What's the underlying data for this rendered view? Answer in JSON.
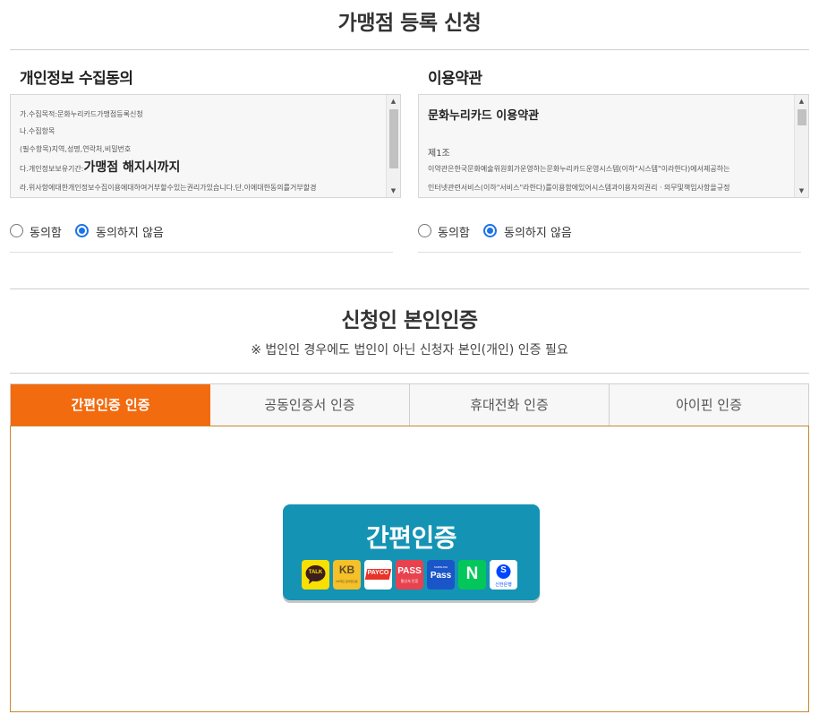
{
  "page": {
    "title": "가맹점 등록 신청"
  },
  "privacy": {
    "title": "개인정보 수집동의",
    "lines": [
      "가.수집목적:문화누리카드가맹점등록신청",
      "나.수집항목",
      "(필수항목)지역,성명,연락처,비밀번호",
      "다.개인정보보유기간:",
      "라.위사항에대한개인정보수집이용에대하여거부할수있는권리가있습니다.단,이에대한동의를거부할경"
    ],
    "emphasis": "가맹점 해지시까지",
    "agree_label": "동의함",
    "disagree_label": "동의하지 않음",
    "selected": "disagree"
  },
  "terms": {
    "title": "이용약관",
    "lines": [
      "문화누리카드 이용약관",
      "제1조",
      "이약관은한국문화예술위원회가운영하는문화누리카드운영시스템(이하\"시스템\"이라한다)에서제공하는",
      "인터넷관련서비스(이하\"서비스\"라한다)를이용함에있어시스템과이용자의권리ㆍ의무및책임사항을규정"
    ],
    "agree_label": "동의함",
    "disagree_label": "동의하지 않음",
    "selected": "disagree"
  },
  "auth": {
    "title": "신청인 본인인증",
    "note": "※ 법인인 경우에도 법인이 아닌 신청자 본인(개인) 인증 필요",
    "tabs": [
      "간편인증 인증",
      "공동인증서 인증",
      "휴대전화 인증",
      "아이핀 인증"
    ],
    "active_tab": 0,
    "easy_button_label": "간편인증",
    "logos": [
      {
        "name": "kakao-talk-icon",
        "text": "TALK",
        "color": "#f9e000"
      },
      {
        "name": "kb-bank-icon",
        "text": "KB",
        "subtext": "KB국민 모바일인증",
        "color": "#f5c028"
      },
      {
        "name": "payco-icon",
        "text": "PAYCO",
        "color": "#ffffff"
      },
      {
        "name": "pass-icon",
        "text": "PASS",
        "subtext": "통신사 인증",
        "color": "#e8424f"
      },
      {
        "name": "samsung-pass-icon",
        "text": "Pass",
        "subtext": "SAMSUNG",
        "color": "#1b56c8"
      },
      {
        "name": "naver-icon",
        "text": "N",
        "color": "#03c75a"
      },
      {
        "name": "shinhan-bank-icon",
        "text": "S",
        "subtext": "신한은행",
        "color": "#ffffff"
      }
    ],
    "accent_color": "#f26b0f",
    "button_color": "#1493b4"
  }
}
